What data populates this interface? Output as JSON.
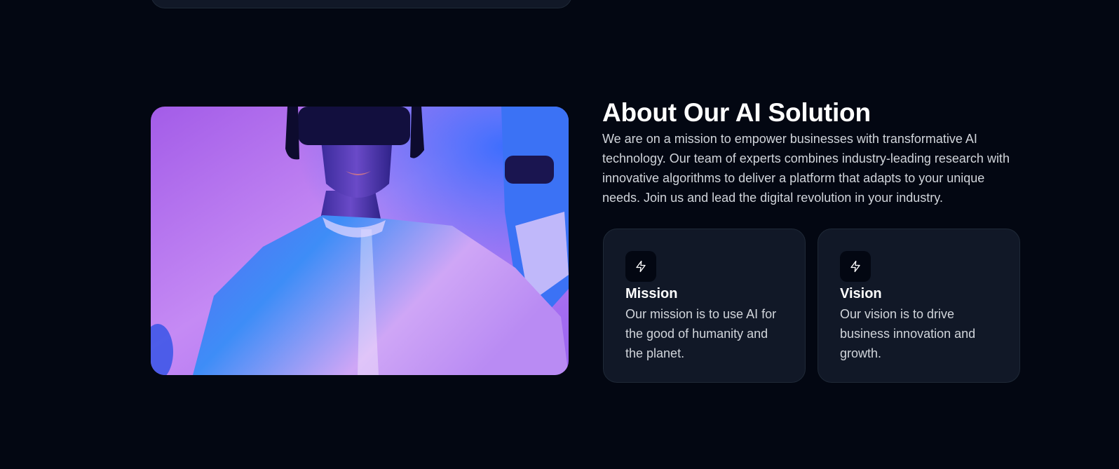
{
  "about": {
    "title": "About Our AI Solution",
    "description": "We are on a mission to empower businesses with transformative AI technology. Our team of experts combines industry-leading research with innovative algorithms to deliver a platform that adapts to your unique needs. Join us and lead the digital revolution in your industry.",
    "image_icon": "vr-headset-photo"
  },
  "cards": [
    {
      "icon": "lightning-icon",
      "title": "Mission",
      "text": "Our mission is to use AI for the good of humanity and the planet."
    },
    {
      "icon": "lightning-icon",
      "title": "Vision",
      "text": "Our vision is to drive business innovation and growth."
    }
  ],
  "colors": {
    "background": "#030712",
    "card": "#111827",
    "card_border": "#1f2937",
    "text_muted": "#d1d5db"
  }
}
